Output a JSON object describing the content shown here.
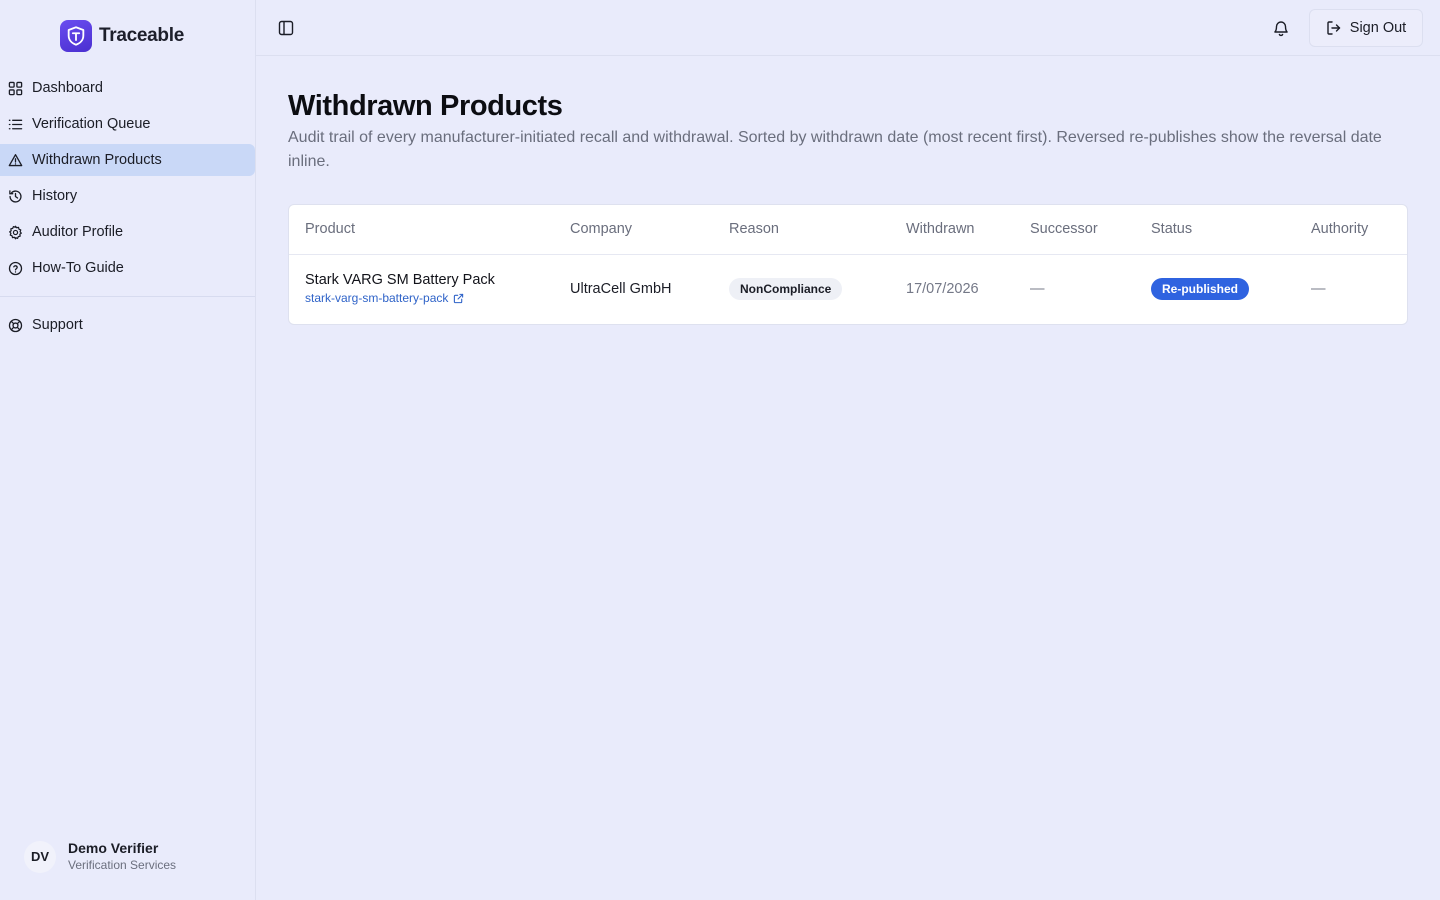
{
  "brand": {
    "name": "Traceable",
    "accent": "#5b3fe0"
  },
  "sidebar": {
    "items": [
      {
        "label": "Dashboard",
        "icon": "grid-icon"
      },
      {
        "label": "Verification Queue",
        "icon": "list-icon"
      },
      {
        "label": "Withdrawn Products",
        "icon": "warning-triangle-icon",
        "active": true
      },
      {
        "label": "History",
        "icon": "history-icon"
      },
      {
        "label": "Auditor Profile",
        "icon": "gear-icon"
      },
      {
        "label": "How-To Guide",
        "icon": "help-circle-icon"
      }
    ],
    "support": {
      "label": "Support",
      "icon": "lifebuoy-icon"
    },
    "user": {
      "initials": "DV",
      "name": "Demo Verifier",
      "org": "Verification Services"
    }
  },
  "topbar": {
    "sign_out_label": "Sign Out"
  },
  "main": {
    "title": "Withdrawn Products",
    "description": "Audit trail of every manufacturer-initiated recall and withdrawal. Sorted by withdrawn date (most recent first). Reversed re-publishes show the reversal date inline."
  },
  "table": {
    "columns": [
      "Product",
      "Company",
      "Reason",
      "Withdrawn",
      "Successor",
      "Status",
      "Authority"
    ],
    "rows": [
      {
        "product_name": "Stark VARG SM Battery Pack",
        "product_slug": "stark-varg-sm-battery-pack",
        "company": "UltraCell GmbH",
        "reason": "NonCompliance",
        "withdrawn": "17/07/2026",
        "successor": "—",
        "status": "Re-published",
        "authority": "—"
      }
    ]
  },
  "colors": {
    "status_republished": "#2f63e0",
    "active_nav": "#c9d8f7",
    "link": "#2f63c8"
  }
}
